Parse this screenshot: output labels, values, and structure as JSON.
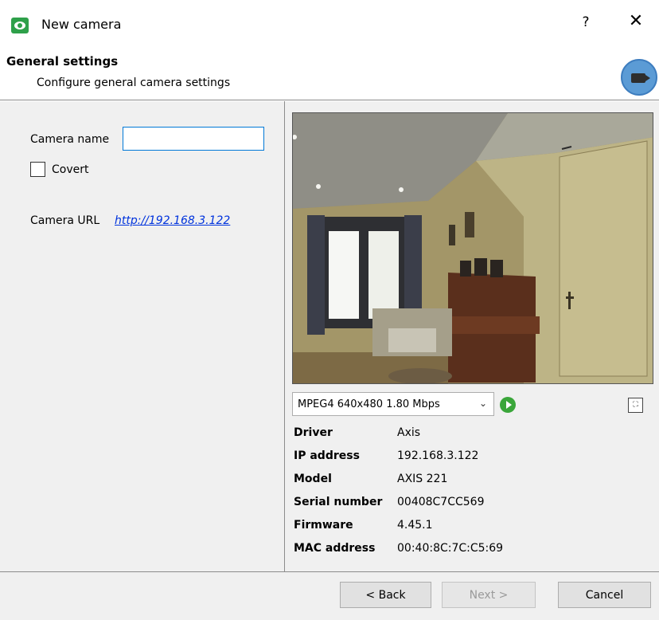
{
  "window": {
    "title": "New camera",
    "help_label": "?",
    "close_label": "✕"
  },
  "header": {
    "title": "General settings",
    "subtitle": "Configure general camera settings"
  },
  "form": {
    "camera_name_label": "Camera name",
    "camera_name_value": "",
    "covert_label": "Covert",
    "covert_checked": false,
    "camera_url_label": "Camera URL",
    "camera_url": "http://192.168.3.122"
  },
  "stream": {
    "selected": "MPEG4 640x480 1.80 Mbps"
  },
  "device_info": [
    {
      "label": "Driver",
      "value": "Axis"
    },
    {
      "label": "IP address",
      "value": "192.168.3.122"
    },
    {
      "label": "Model",
      "value": "AXIS 221"
    },
    {
      "label": "Serial number",
      "value": "00408C7CC569"
    },
    {
      "label": "Firmware",
      "value": "4.45.1"
    },
    {
      "label": "MAC address",
      "value": "00:40:8C:7C:C5:69"
    }
  ],
  "footer": {
    "back_label": "< Back",
    "next_label": "Next >",
    "cancel_label": "Cancel"
  },
  "icons": {
    "app": "eye-icon",
    "header": "camera-icon",
    "play": "play-icon",
    "fit": "fit-to-window-icon",
    "dropdown": "chevron-down-icon"
  },
  "colors": {
    "accent_input": "#0078d7",
    "link": "#0033dd",
    "play": "#3aa63a",
    "badge": "#5b9bd5"
  }
}
